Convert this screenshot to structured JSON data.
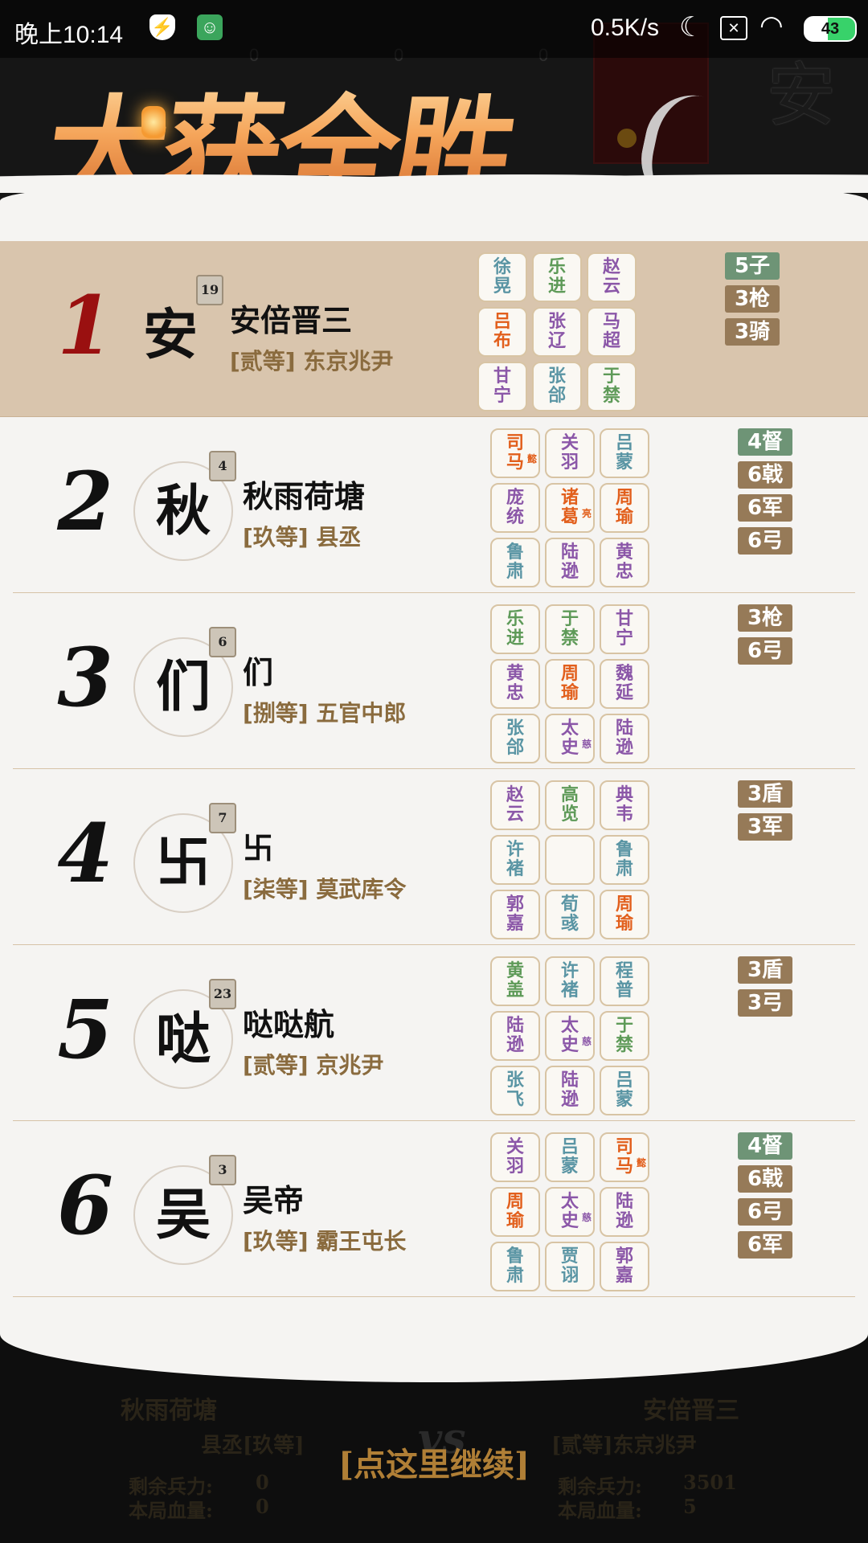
{
  "status_bar": {
    "time": "晚上10:14",
    "speed": "0.5K/s",
    "battery": "43"
  },
  "header": {
    "title": "大获全胜",
    "ghost_numbers": [
      "0",
      "0",
      "0"
    ],
    "ghost_glyph": "安"
  },
  "rows": [
    {
      "rank": "1",
      "avatar": "安",
      "level": "19",
      "name": "安倍晋三",
      "title": "[贰等] 东京兆尹",
      "generals": [
        {
          "text": "徐\n晃",
          "color": "teal"
        },
        {
          "text": "乐\n进",
          "color": "green"
        },
        {
          "text": "赵\n云",
          "color": "purple"
        },
        {
          "text": "吕\n布",
          "color": "orange"
        },
        {
          "text": "张\n辽",
          "color": "purple"
        },
        {
          "text": "马\n超",
          "color": "purple"
        },
        {
          "text": "甘\n宁",
          "color": "purple"
        },
        {
          "text": "张\n郃",
          "color": "teal"
        },
        {
          "text": "于\n禁",
          "color": "green"
        }
      ],
      "badges": [
        {
          "text": "5子",
          "color": "green"
        },
        {
          "text": "3枪",
          "color": "brown"
        },
        {
          "text": "3骑",
          "color": "brown"
        }
      ]
    },
    {
      "rank": "2",
      "avatar": "秋",
      "level": "4",
      "name": "秋雨荷塘",
      "title": "[玖等] 县丞",
      "generals": [
        {
          "text": "司\n马",
          "color": "orange",
          "sup": "懿"
        },
        {
          "text": "关\n羽",
          "color": "purple"
        },
        {
          "text": "吕\n蒙",
          "color": "teal"
        },
        {
          "text": "庞\n统",
          "color": "purple"
        },
        {
          "text": "诸\n葛",
          "color": "orange",
          "sup": "亮"
        },
        {
          "text": "周\n瑜",
          "color": "orange"
        },
        {
          "text": "鲁\n肃",
          "color": "teal"
        },
        {
          "text": "陆\n逊",
          "color": "purple"
        },
        {
          "text": "黄\n忠",
          "color": "purple"
        }
      ],
      "badges": [
        {
          "text": "4督",
          "color": "green"
        },
        {
          "text": "6戟",
          "color": "brown"
        },
        {
          "text": "6军",
          "color": "brown"
        },
        {
          "text": "6弓",
          "color": "brown"
        }
      ]
    },
    {
      "rank": "3",
      "avatar": "们",
      "level": "6",
      "name": "们",
      "title": "[捌等] 五官中郎",
      "generals": [
        {
          "text": "乐\n进",
          "color": "green"
        },
        {
          "text": "于\n禁",
          "color": "green"
        },
        {
          "text": "甘\n宁",
          "color": "purple"
        },
        {
          "text": "黄\n忠",
          "color": "purple"
        },
        {
          "text": "周\n瑜",
          "color": "orange"
        },
        {
          "text": "魏\n延",
          "color": "purple"
        },
        {
          "text": "张\n郃",
          "color": "teal"
        },
        {
          "text": "太\n史",
          "color": "purple",
          "sup": "慈"
        },
        {
          "text": "陆\n逊",
          "color": "purple"
        }
      ],
      "badges": [
        {
          "text": "3枪",
          "color": "brown"
        },
        {
          "text": "6弓",
          "color": "brown"
        }
      ]
    },
    {
      "rank": "4",
      "avatar": "卐",
      "level": "7",
      "name": "卐",
      "title": "[柒等] 莫武库令",
      "generals": [
        {
          "text": "赵\n云",
          "color": "purple"
        },
        {
          "text": "高\n览",
          "color": "green"
        },
        {
          "text": "典\n韦",
          "color": "purple"
        },
        {
          "text": "许\n褚",
          "color": "teal"
        },
        {
          "text": "",
          "color": "teal"
        },
        {
          "text": "鲁\n肃",
          "color": "teal"
        },
        {
          "text": "郭\n嘉",
          "color": "purple"
        },
        {
          "text": "荀\n彧",
          "color": "teal"
        },
        {
          "text": "周\n瑜",
          "color": "orange"
        }
      ],
      "badges": [
        {
          "text": "3盾",
          "color": "brown"
        },
        {
          "text": "3军",
          "color": "brown"
        }
      ]
    },
    {
      "rank": "5",
      "avatar": "哒",
      "level": "23",
      "name": "哒哒航",
      "title": "[贰等] 京兆尹",
      "generals": [
        {
          "text": "黄\n盖",
          "color": "green"
        },
        {
          "text": "许\n褚",
          "color": "teal"
        },
        {
          "text": "程\n普",
          "color": "teal"
        },
        {
          "text": "陆\n逊",
          "color": "purple"
        },
        {
          "text": "太\n史",
          "color": "purple",
          "sup": "慈"
        },
        {
          "text": "于\n禁",
          "color": "green"
        },
        {
          "text": "张\n飞",
          "color": "teal"
        },
        {
          "text": "陆\n逊",
          "color": "purple"
        },
        {
          "text": "吕\n蒙",
          "color": "teal"
        }
      ],
      "badges": [
        {
          "text": "3盾",
          "color": "brown"
        },
        {
          "text": "3弓",
          "color": "brown"
        }
      ]
    },
    {
      "rank": "6",
      "avatar": "吴",
      "level": "3",
      "name": "吴帝",
      "title": "[玖等] 霸王屯长",
      "generals": [
        {
          "text": "关\n羽",
          "color": "purple"
        },
        {
          "text": "吕\n蒙",
          "color": "teal"
        },
        {
          "text": "司\n马",
          "color": "orange",
          "sup": "懿"
        },
        {
          "text": "周\n瑜",
          "color": "orange"
        },
        {
          "text": "太\n史",
          "color": "purple",
          "sup": "慈"
        },
        {
          "text": "陆\n逊",
          "color": "purple"
        },
        {
          "text": "鲁\n肃",
          "color": "teal"
        },
        {
          "text": "贾\n诩",
          "color": "teal"
        },
        {
          "text": "郭\n嘉",
          "color": "purple"
        }
      ],
      "badges": [
        {
          "text": "4督",
          "color": "green"
        },
        {
          "text": "6戟",
          "color": "brown"
        },
        {
          "text": "6弓",
          "color": "brown"
        },
        {
          "text": "6军",
          "color": "brown"
        }
      ]
    }
  ],
  "footer": {
    "left_name": "秋雨荷塘",
    "left_title": "县丞[玖等]",
    "left_troops_label": "剩余兵力:",
    "left_troops": "0",
    "left_hp_label": "本局血量:",
    "left_hp": "0",
    "vs": "vs",
    "continue_label": "[点这里继续]",
    "right_name": "安倍晋三",
    "right_title": "[贰等]东京兆尹",
    "right_troops_label": "剩余兵力:",
    "right_troops": "3501",
    "right_hp_label": "本局血量:",
    "right_hp": "5"
  }
}
